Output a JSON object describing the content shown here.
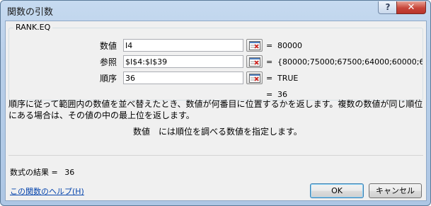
{
  "dialog": {
    "title": "関数の引数",
    "help_button": "?",
    "close_button": "✕"
  },
  "function_group": {
    "name": "RANK.EQ",
    "args": [
      {
        "label": "数値",
        "value": "I4",
        "result": "80000"
      },
      {
        "label": "参照",
        "value": "$I$4:$I$39",
        "result": "{80000;75000;67500;64000;60000;6000..."
      },
      {
        "label": "順序",
        "value": "36",
        "result": "TRUE"
      }
    ]
  },
  "function_result": {
    "eq": "=",
    "value": "36"
  },
  "description": "順序に従って範囲内の数値を並べ替えたとき、数値が何番目に位置するかを返します。複数の数値が同じ順位にある場合は、その値の中の最上位を返します。",
  "arg_description": "数値　には順位を調べる数値を指定します。",
  "formula_result": {
    "label": "数式の結果 =",
    "value": "36"
  },
  "help_link": "この関数のヘルプ(H)",
  "buttons": {
    "ok": "OK",
    "cancel": "キャンセル"
  },
  "icons": {
    "ref": "collapse-dialog-icon"
  }
}
